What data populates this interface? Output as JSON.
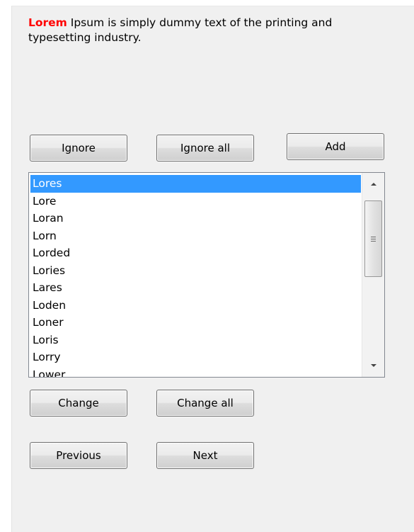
{
  "message": {
    "highlight": "Lorem",
    "text": " Ipsum is simply dummy text of the printing and typesetting industry.",
    "highlight_color": "#ff0000"
  },
  "buttons": {
    "ignore": "Ignore",
    "ignore_all": "Ignore all",
    "add": "Add",
    "change": "Change",
    "change_all": "Change all",
    "previous": "Previous",
    "next": "Next"
  },
  "suggestions": {
    "selected_index": 0,
    "selected_color": "#3399ff",
    "items": [
      "Lores",
      "Lore",
      "Loran",
      "Lorn",
      "Lorded",
      "Lories",
      "Lares",
      "Loden",
      "Loner",
      "Loris",
      "Lorry",
      "Lower"
    ]
  },
  "icons": {
    "scroll_up": "triangle-up-icon",
    "scroll_down": "triangle-down-icon",
    "thumb_grip": "grip-lines-icon"
  }
}
